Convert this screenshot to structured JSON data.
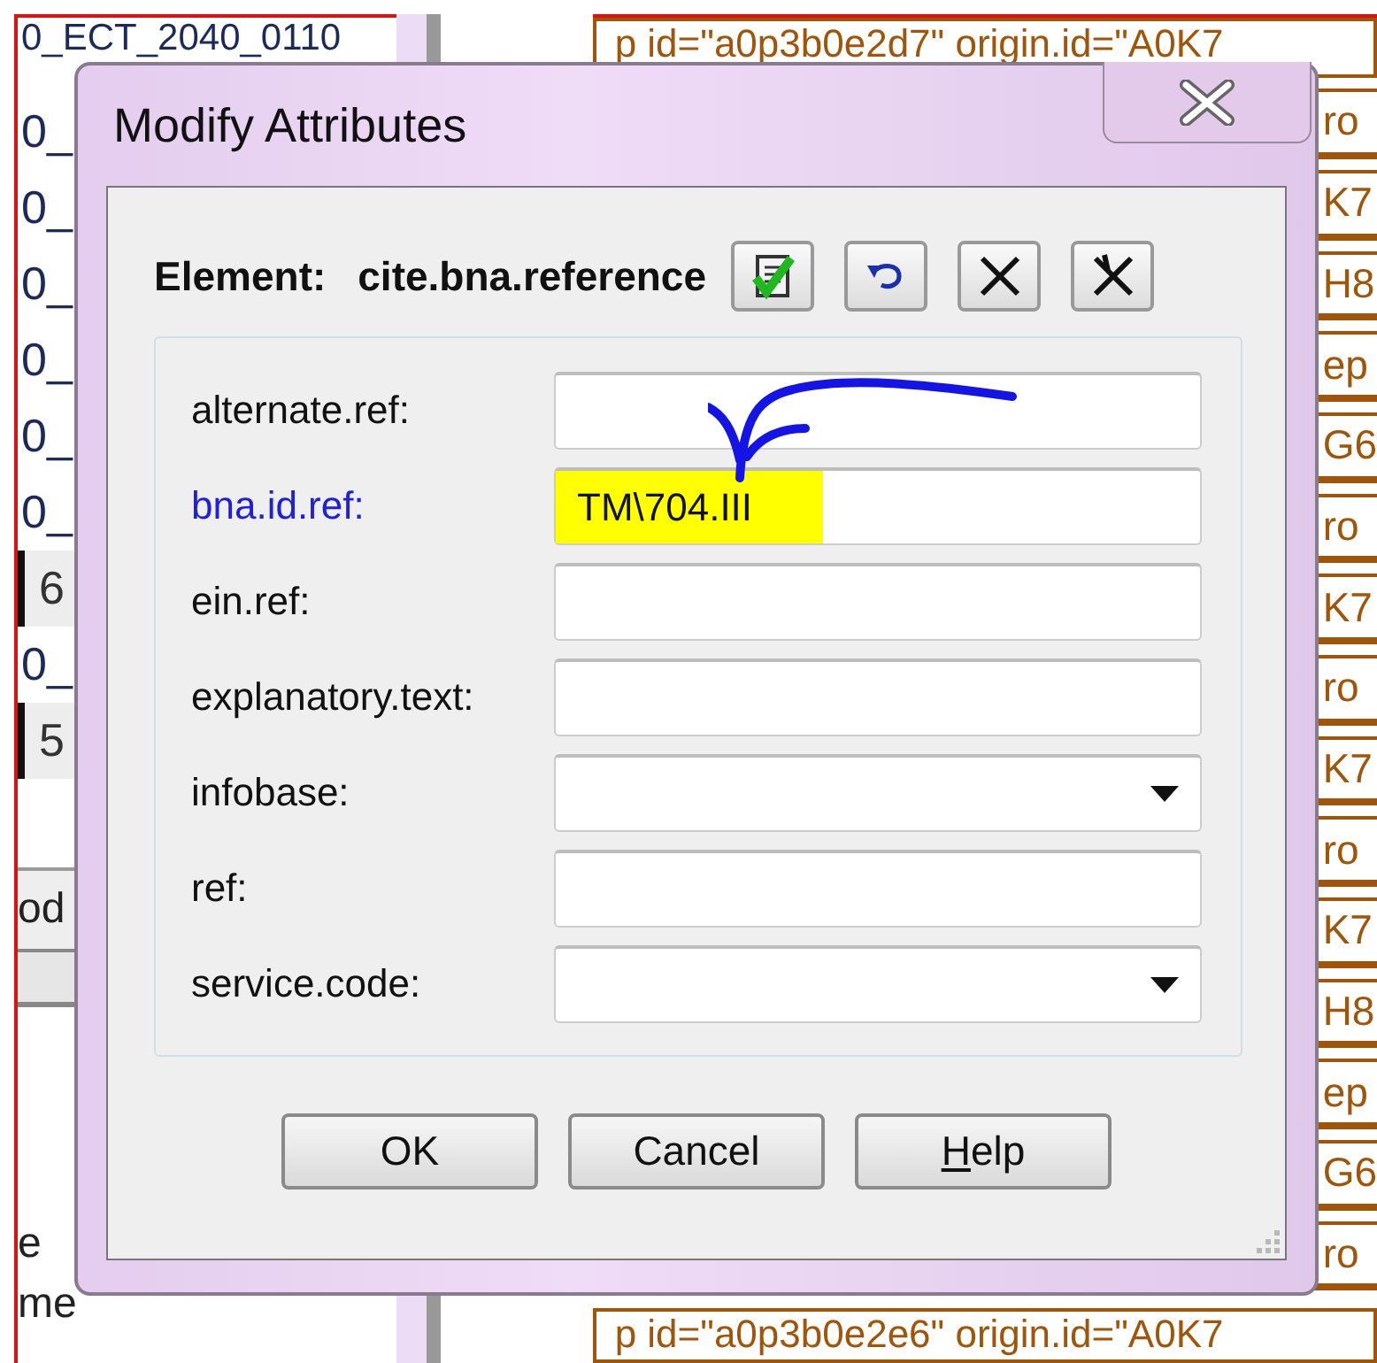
{
  "background": {
    "left_items": [
      {
        "text": "0_ECT_2040_0110",
        "kind": "row"
      },
      {
        "text": "0_",
        "kind": "row"
      },
      {
        "text": "0_",
        "kind": "row"
      },
      {
        "text": "0_",
        "kind": "row"
      },
      {
        "text": "0_",
        "kind": "row"
      },
      {
        "text": "0_",
        "kind": "row"
      },
      {
        "text": "0_",
        "kind": "row"
      },
      {
        "text": "6",
        "kind": "marked"
      },
      {
        "text": "0_",
        "kind": "row"
      },
      {
        "text": "5",
        "kind": "marked"
      }
    ],
    "left_button": "od",
    "left_lower": [
      "e",
      "me"
    ],
    "right_header": "p id=\"a0p3b0e2d7\" origin.id=\"A0K7",
    "right_rows": [
      "ro",
      "K7",
      "H8",
      "ep",
      "G6",
      "ro",
      "K7",
      "ro",
      "K7",
      "ro",
      "K7",
      "H8",
      "ep",
      "G6",
      "ro"
    ],
    "right_footer": "p id=\"a0p3b0e2e6\" origin.id=\"A0K7"
  },
  "dialog": {
    "title": "Modify Attributes",
    "element_label": "Element:",
    "element_name": "cite.bna.reference",
    "fields": [
      {
        "label": "alternate.ref:",
        "kind": "text",
        "emphasized": false
      },
      {
        "label": "bna.id.ref:",
        "kind": "text",
        "emphasized": true,
        "value": "TM\\704.III",
        "highlighted": true
      },
      {
        "label": "ein.ref:",
        "kind": "text",
        "emphasized": false
      },
      {
        "label": "explanatory.text:",
        "kind": "text",
        "emphasized": false
      },
      {
        "label": "infobase:",
        "kind": "dropdown",
        "emphasized": false
      },
      {
        "label": "ref:",
        "kind": "text",
        "emphasized": false
      },
      {
        "label": "service.code:",
        "kind": "dropdown",
        "emphasized": false
      }
    ],
    "buttons": [
      {
        "label": "OK",
        "mnemonic": false
      },
      {
        "label": "Cancel",
        "mnemonic": false
      },
      {
        "label": "Help",
        "mnemonic": true
      }
    ]
  }
}
